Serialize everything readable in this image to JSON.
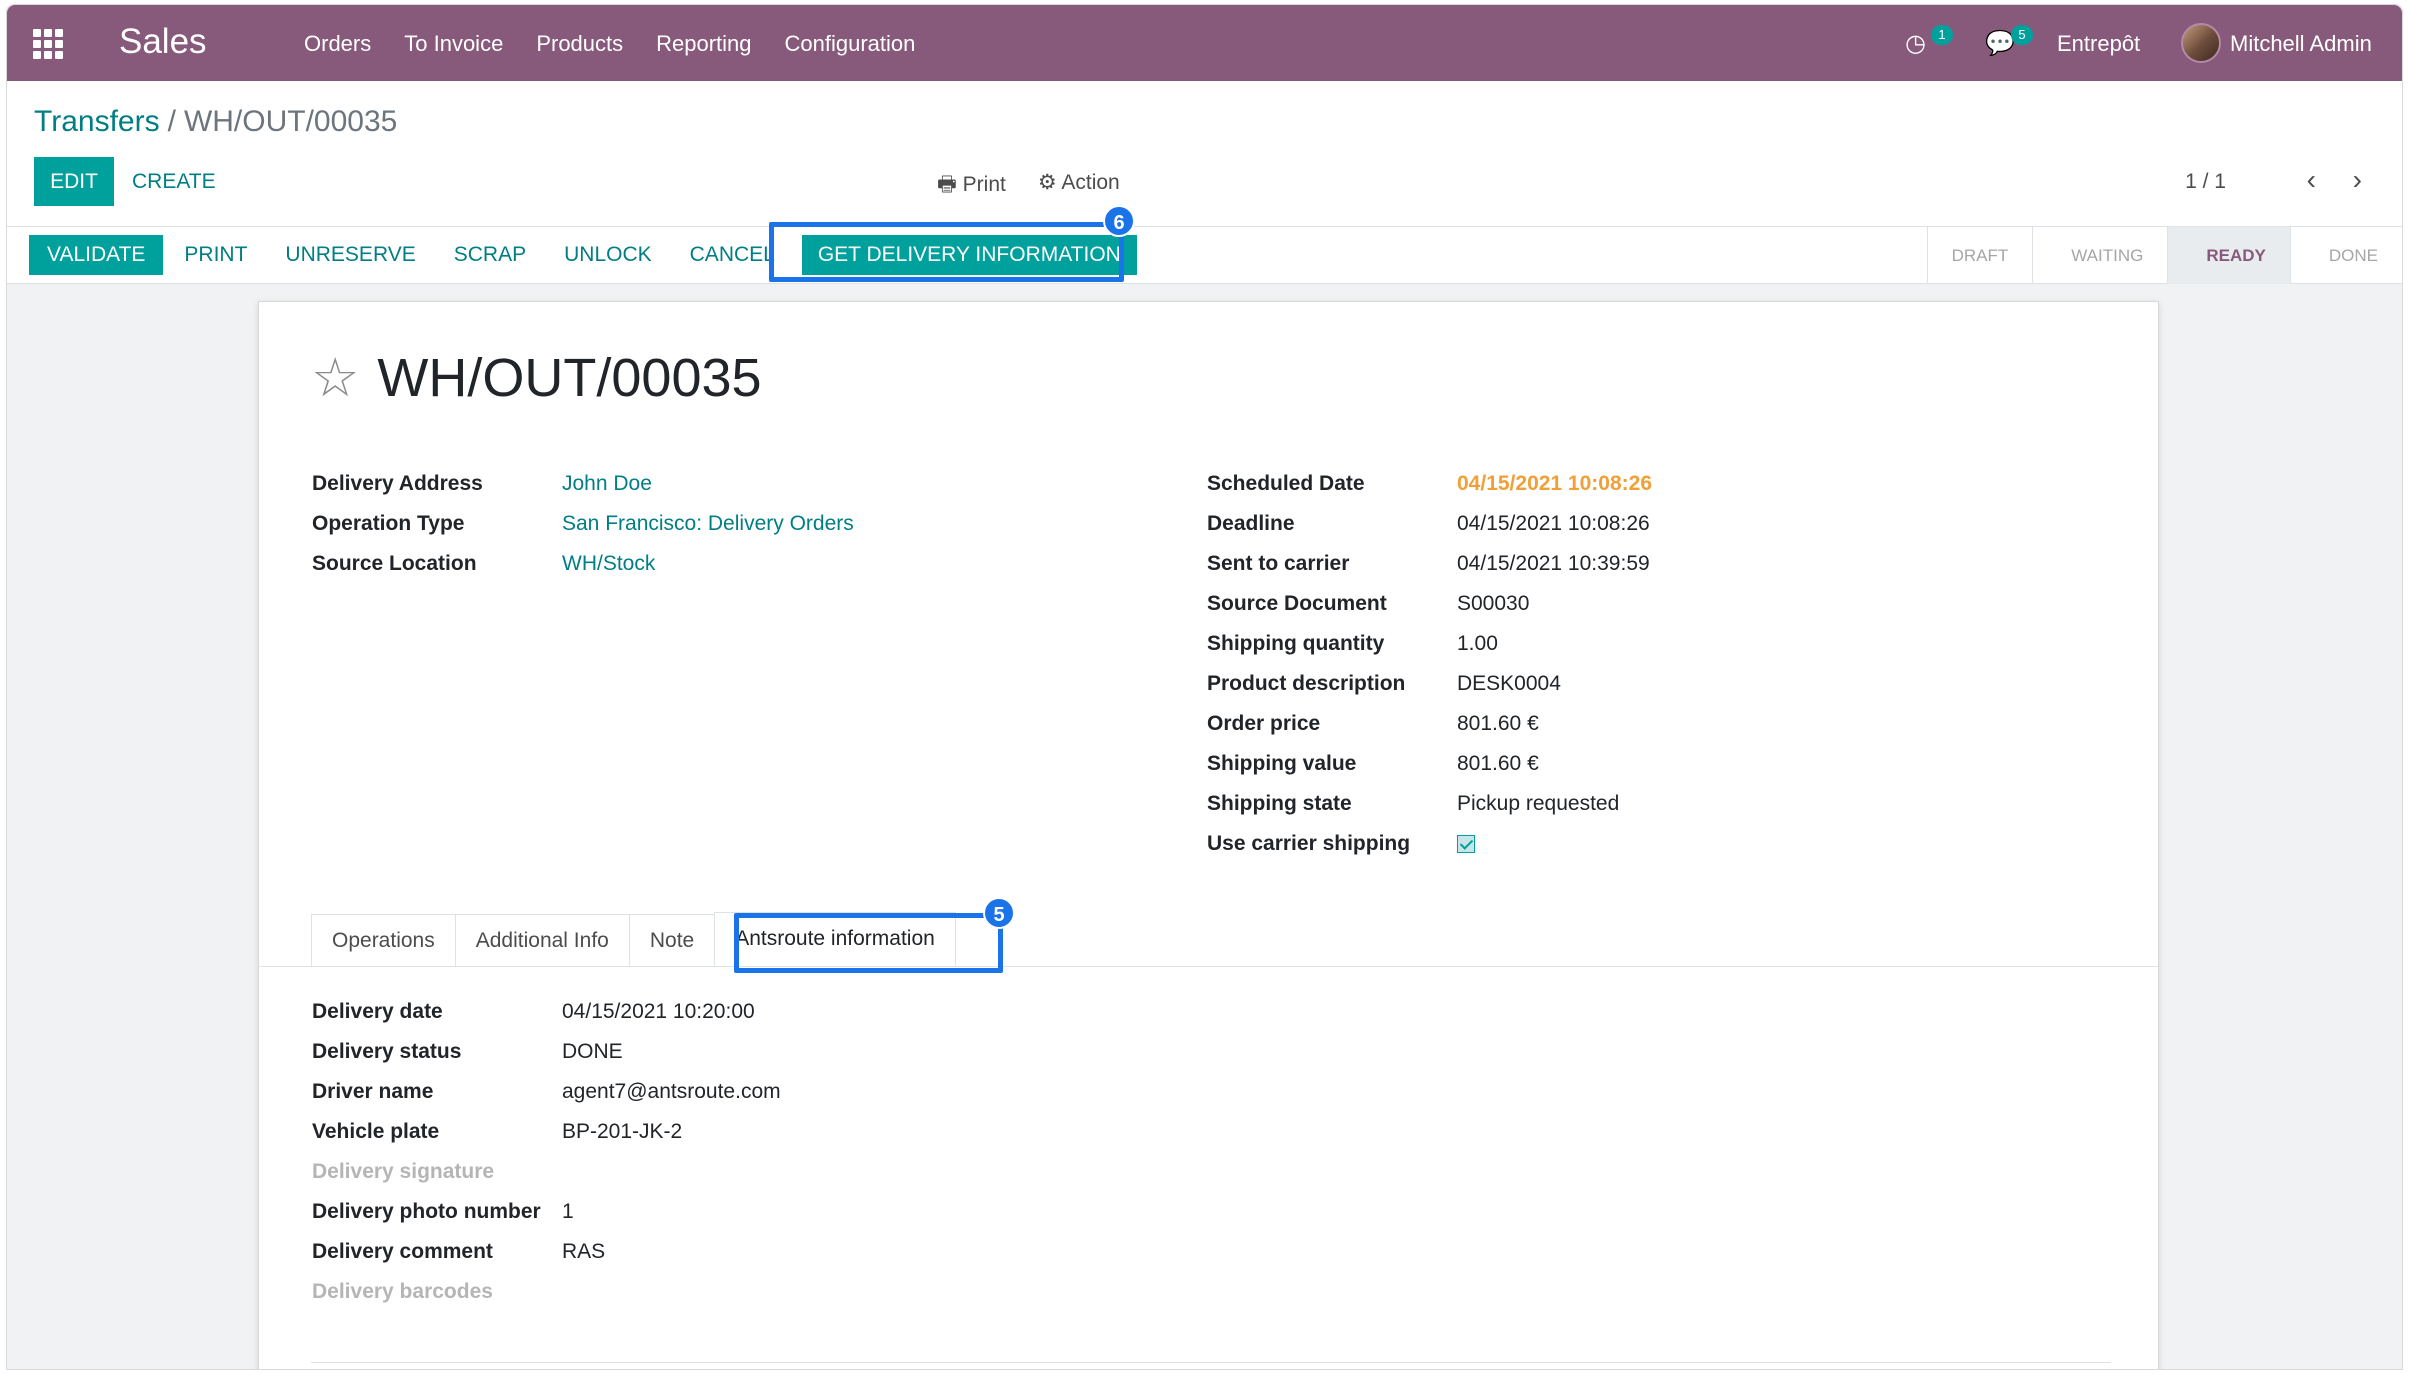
{
  "navbar": {
    "brand": "Sales",
    "menu": [
      "Orders",
      "To Invoice",
      "Products",
      "Reporting",
      "Configuration"
    ],
    "activity_badge": "1",
    "messages_badge": "5",
    "company": "Entrepôt",
    "user": "Mitchell Admin",
    "color": "#875a7b"
  },
  "control": {
    "breadcrumb_parent": "Transfers",
    "breadcrumb_sep": "/",
    "breadcrumb_current": "WH/OUT/00035",
    "edit_label": "EDIT",
    "create_label": "CREATE",
    "print_label": "Print",
    "action_label": "Action",
    "pager": "1 / 1"
  },
  "statusbar": {
    "buttons": [
      "VALIDATE",
      "PRINT",
      "UNRESERVE",
      "SCRAP",
      "UNLOCK",
      "CANCEL"
    ],
    "get_delivery_label": "GET DELIVERY INFORMATION",
    "step_badge": "6",
    "stages": [
      "DRAFT",
      "WAITING",
      "READY",
      "DONE"
    ],
    "active_stage": "READY",
    "accent": "#00a09d",
    "highlight": "#1a73e8"
  },
  "form": {
    "title": "WH/OUT/00035",
    "left_fields": [
      {
        "label": "Delivery Address",
        "value": "John Doe"
      },
      {
        "label": "Operation Type",
        "value": "San Francisco: Delivery Orders"
      },
      {
        "label": "Source Location",
        "value": "WH/Stock"
      }
    ],
    "right_fields": [
      {
        "label": "Scheduled Date",
        "value": "04/15/2021 10:08:26"
      },
      {
        "label": "Deadline",
        "value": "04/15/2021 10:08:26"
      },
      {
        "label": "Sent to carrier",
        "value": "04/15/2021 10:39:59"
      },
      {
        "label": "Source Document",
        "value": "S00030"
      },
      {
        "label": "Shipping quantity",
        "value": "1.00"
      },
      {
        "label": "Product description",
        "value": "DESK0004"
      },
      {
        "label": "Order price",
        "value": "801.60 €"
      },
      {
        "label": "Shipping value",
        "value": "801.60 €"
      },
      {
        "label": "Shipping state",
        "value": "Pickup requested"
      },
      {
        "label": "Use carrier shipping",
        "value": ""
      }
    ],
    "tabs": [
      "Operations",
      "Additional Info",
      "Note",
      "Antsroute information"
    ],
    "tab_step_badge": "5",
    "tab_fields": [
      {
        "label": "Delivery date",
        "value": "04/15/2021 10:20:00"
      },
      {
        "label": "Delivery status",
        "value": "DONE"
      },
      {
        "label": "Driver name",
        "value": "agent7@antsroute.com"
      },
      {
        "label": "Vehicle plate",
        "value": "BP-201-JK-2"
      },
      {
        "label": "Delivery signature",
        "value": ""
      },
      {
        "label": "Delivery photo number",
        "value": "1"
      },
      {
        "label": "Delivery comment",
        "value": "RAS"
      },
      {
        "label": "Delivery barcodes",
        "value": ""
      }
    ]
  }
}
